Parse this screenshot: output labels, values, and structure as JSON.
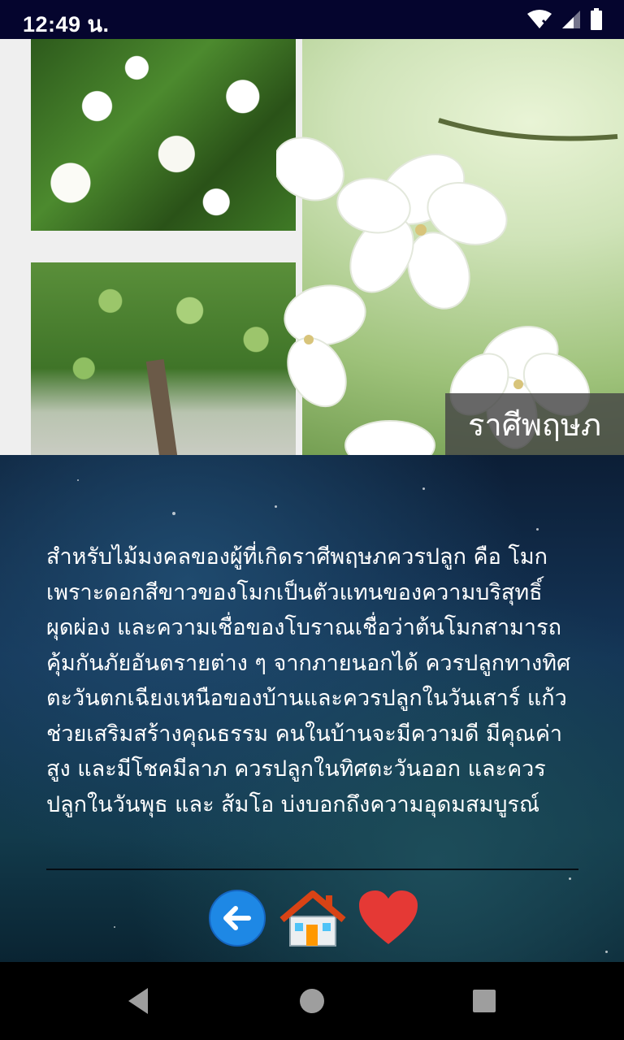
{
  "status_bar": {
    "time": "12:49 น."
  },
  "hero": {
    "caption": "ราศีพฤษภ"
  },
  "content": {
    "description": "สำหรับไม้มงคลของผู้ที่เกิดราศีพฤษภควรปลูก คือ โมก เพราะดอกสีขาวของโมกเป็นตัวแทนของความบริสุทธิ์ผุดผ่อง และความเชื่อของโบราณเชื่อว่าต้นโมกสามารถคุ้มกันภัยอันตรายต่าง ๆ จากภายนอกได้ ควรปลูกทางทิศตะวันตกเฉียงเหนือของบ้านและควรปลูกในวันเสาร์ แก้ว ช่วยเสริมสร้างคุณธรรม คนในบ้านจะมีความดี มีคุณค่าสูง และมีโชคมีลาภ ควรปลูกในทิศตะวันออก และควรปลูกในวันพุธ และ ส้มโอ บ่งบอกถึงความอุดมสมบูรณ์"
  },
  "actions": {
    "back_icon": "arrow-left-circle",
    "home_icon": "house",
    "favorite_icon": "heart"
  },
  "colors": {
    "status_bar": "#05052e",
    "back_button": "#1e88e5",
    "heart": "#e53935",
    "caption_bg": "#464646"
  }
}
